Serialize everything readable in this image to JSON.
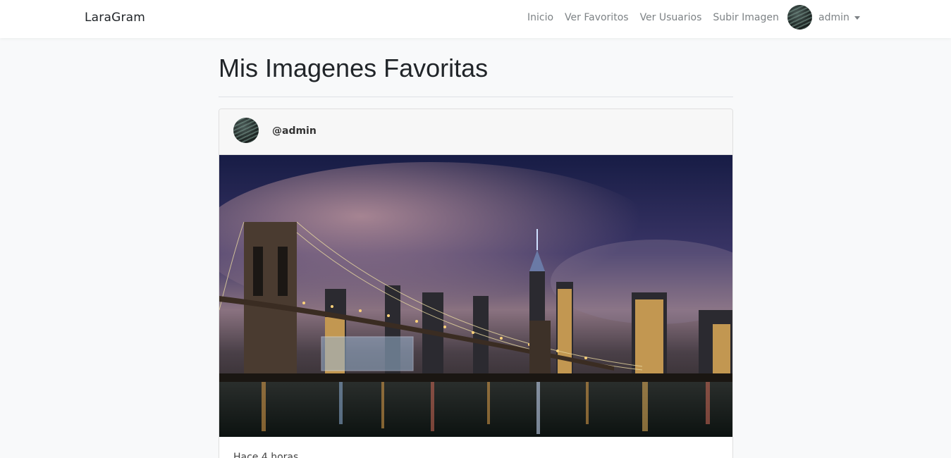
{
  "navbar": {
    "brand": "LaraGram",
    "links": [
      "Inicio",
      "Ver Favoritos",
      "Ver Usuarios",
      "Subir Imagen"
    ],
    "user": "admin"
  },
  "page": {
    "title": "Mis Imagenes Favoritas"
  },
  "post": {
    "username": "@admin",
    "time": "Hace 4 horas",
    "image_alt": "Brooklyn Bridge and Manhattan skyline at night"
  },
  "colors": {
    "background": "#f8f9fa",
    "navbar": "#ffffff",
    "nav_text": "#7d8285"
  }
}
